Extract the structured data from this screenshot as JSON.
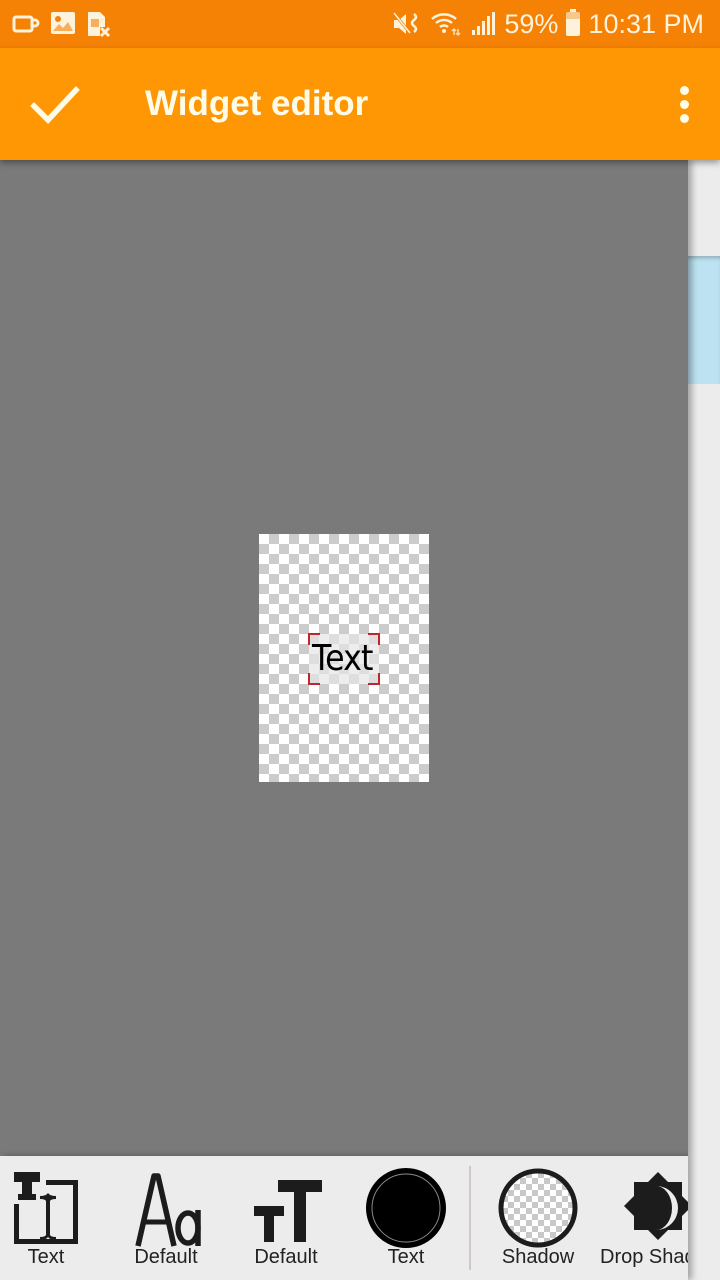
{
  "status_bar": {
    "left_icons": [
      "cup-notification-icon",
      "image-notification-icon",
      "sim-blocked-icon"
    ],
    "right_icons": [
      "mute-vibrate-icon",
      "wifi-icon",
      "signal-icon"
    ],
    "battery_percent": "59%",
    "time": "10:31 PM"
  },
  "app_bar": {
    "title": "Widget editor",
    "confirm_icon": "check-icon",
    "overflow_icon": "more-vert-icon"
  },
  "canvas": {
    "element_text": "Text",
    "selection_color": "#c0262a"
  },
  "toolbar": {
    "items": [
      {
        "label": "Text",
        "icon": "text-edit-icon"
      },
      {
        "label": "Default",
        "icon": "font-family-icon",
        "glyph": "Aa"
      },
      {
        "label": "Default",
        "icon": "font-size-icon"
      },
      {
        "label": "Text",
        "icon": "text-color-swatch-icon",
        "color": "#000000"
      },
      {
        "label": "Shadow",
        "icon": "shadow-color-swatch-icon"
      },
      {
        "label": "Drop Shadow",
        "icon": "drop-shadow-icon"
      }
    ]
  },
  "colors": {
    "status_bar": "#f58105",
    "app_bar": "#fe9703",
    "workspace": "#7a7a7a",
    "toolbar": "#ececec",
    "side_panel_accent": "#bde3f3"
  }
}
